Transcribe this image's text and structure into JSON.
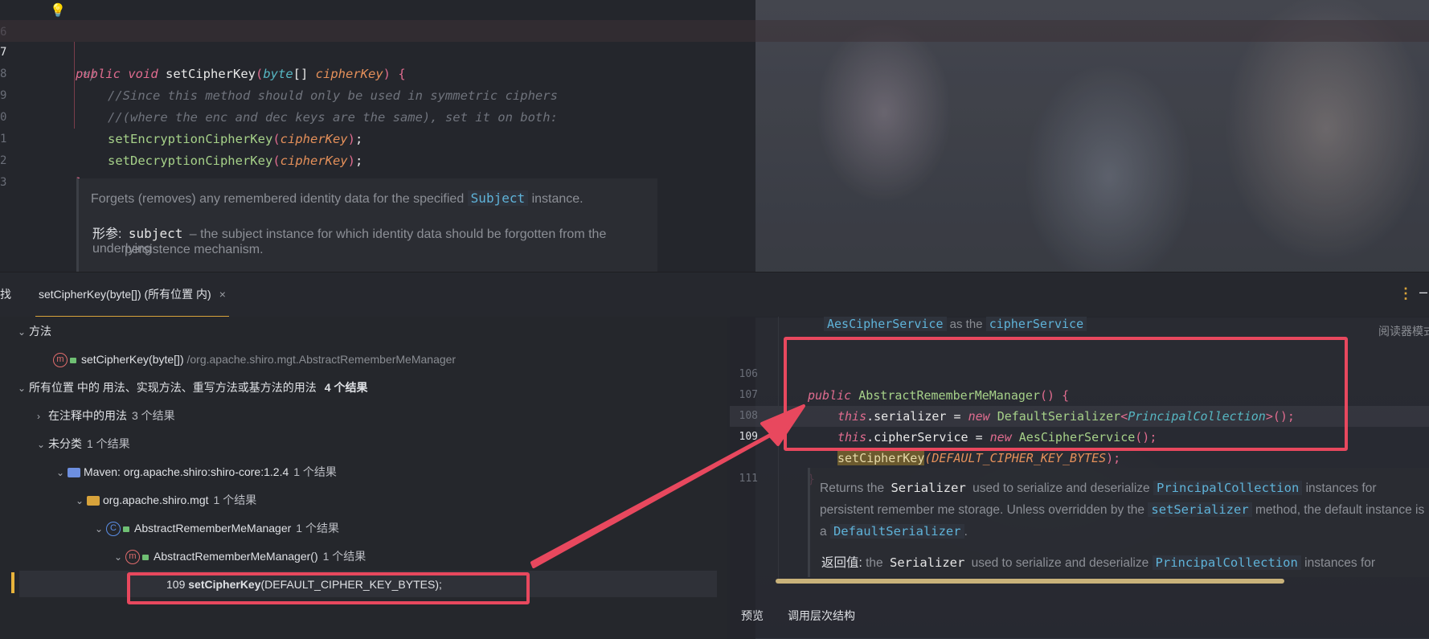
{
  "editor": {
    "lines": [
      {
        "num": "6",
        "text": "*/"
      },
      {
        "num": "7"
      },
      {
        "num": "8",
        "text": "//Since this method should only be used in symmetric ciphers"
      },
      {
        "num": "9",
        "text": "//(where the enc and dec keys are the same), set it on both:"
      },
      {
        "num": "0"
      },
      {
        "num": "1"
      },
      {
        "num": "2",
        "text": "}"
      },
      {
        "num": "3"
      }
    ],
    "sig": {
      "kw1": "public",
      "kw2": "void",
      "name": "setCipherKey",
      "ptype": "byte",
      "arr": "[] ",
      "param": "cipherKey",
      "tail": ") {"
    },
    "calls": [
      {
        "name": "setEncryptionCipherKey",
        "arg": "cipherKey"
      },
      {
        "name": "setDecryptionCipherKey",
        "arg": "cipherKey"
      }
    ],
    "doc": {
      "line1a": "Forgets (removes) any remembered identity data for the specified",
      "line1chip": "Subject",
      "line1b": "instance.",
      "param_label": "形参:",
      "param_name": "subject",
      "param_dash": "–",
      "param_desc1": "the subject instance for which identity data should be forgotten from the underlying",
      "param_desc2": "persistence mechanism."
    }
  },
  "find": {
    "left_fragment": "找",
    "tab_label": "setCipherKey(byte[]) (所有位置 内)",
    "close": "×",
    "more": "⋮",
    "minimize": "–"
  },
  "tree": {
    "methods_header": "方法",
    "method_item": "setCipherKey(byte[])",
    "method_path": "/org.apache.shiro.mgt.AbstractRememberMeManager",
    "usages_header": "所有位置 中的 用法、实现方法、重写方法或基方法的用法",
    "usages_count": "4 个结果",
    "in_comments": "在注释中的用法",
    "in_comments_count": "3 个结果",
    "unclassified": "未分类",
    "unclassified_count": "1 个结果",
    "maven": "Maven: org.apache.shiro:shiro-core:1.2.4",
    "maven_count": "1 个结果",
    "package": "org.apache.shiro.mgt",
    "package_count": "1 个结果",
    "class": "AbstractRememberMeManager",
    "class_count": "1 个结果",
    "ctor": "AbstractRememberMeManager()",
    "ctor_count": "1 个结果",
    "result_line": "109",
    "result_call": "setCipherKey",
    "result_rest": "(DEFAULT_CIPHER_KEY_BYTES);"
  },
  "preview": {
    "top_fragment_a": "AesCipherService",
    "top_fragment_b": "as the",
    "top_fragment_c": "cipherService",
    "reader_mode": "阅读器模式",
    "lines": [
      {
        "num": "106"
      },
      {
        "num": "107"
      },
      {
        "num": "108"
      },
      {
        "num": "109"
      },
      {
        "num": ""
      },
      {
        "num": "111"
      }
    ],
    "l106": {
      "kw": "public",
      "name": "AbstractRememberMeManager",
      "tail": "() {"
    },
    "l107": {
      "this": "this",
      "field": ".serializer",
      "eq": " = ",
      "new": "new",
      "cls": "DefaultSerializer",
      "lt": "<",
      "gen": "PrincipalCollection",
      "gt": ">();"
    },
    "l108": {
      "this": "this",
      "field": ".cipherService",
      "eq": " = ",
      "new": "new",
      "cls": "AesCipherService",
      "tail": "();"
    },
    "l109": {
      "call": "setCipherKey",
      "arg": "(DEFAULT_CIPHER_KEY_BYTES",
      "close": ");"
    },
    "l110": "}",
    "doc": {
      "a1": "Returns the",
      "a2": "Serializer",
      "a3": "used to serialize and deserialize",
      "a4": "PrincipalCollection",
      "a5": "instances for",
      "b1": "persistent remember me storage. Unless overridden by the",
      "b2": "setSerializer",
      "b3": "method, the default instance is",
      "c1": "a",
      "c2": "DefaultSerializer",
      "c3": ".",
      "r1": "返回值:",
      "r2": "the",
      "r3": "Serializer",
      "r4": "used to serialize and deserialize",
      "r5": "PrincipalCollection",
      "r6": "instances for"
    },
    "tab_preview": "预览",
    "tab_hierarchy": "调用层次结构"
  },
  "colors": {
    "highlight": "#e8485e",
    "accent": "#d8a33b"
  }
}
